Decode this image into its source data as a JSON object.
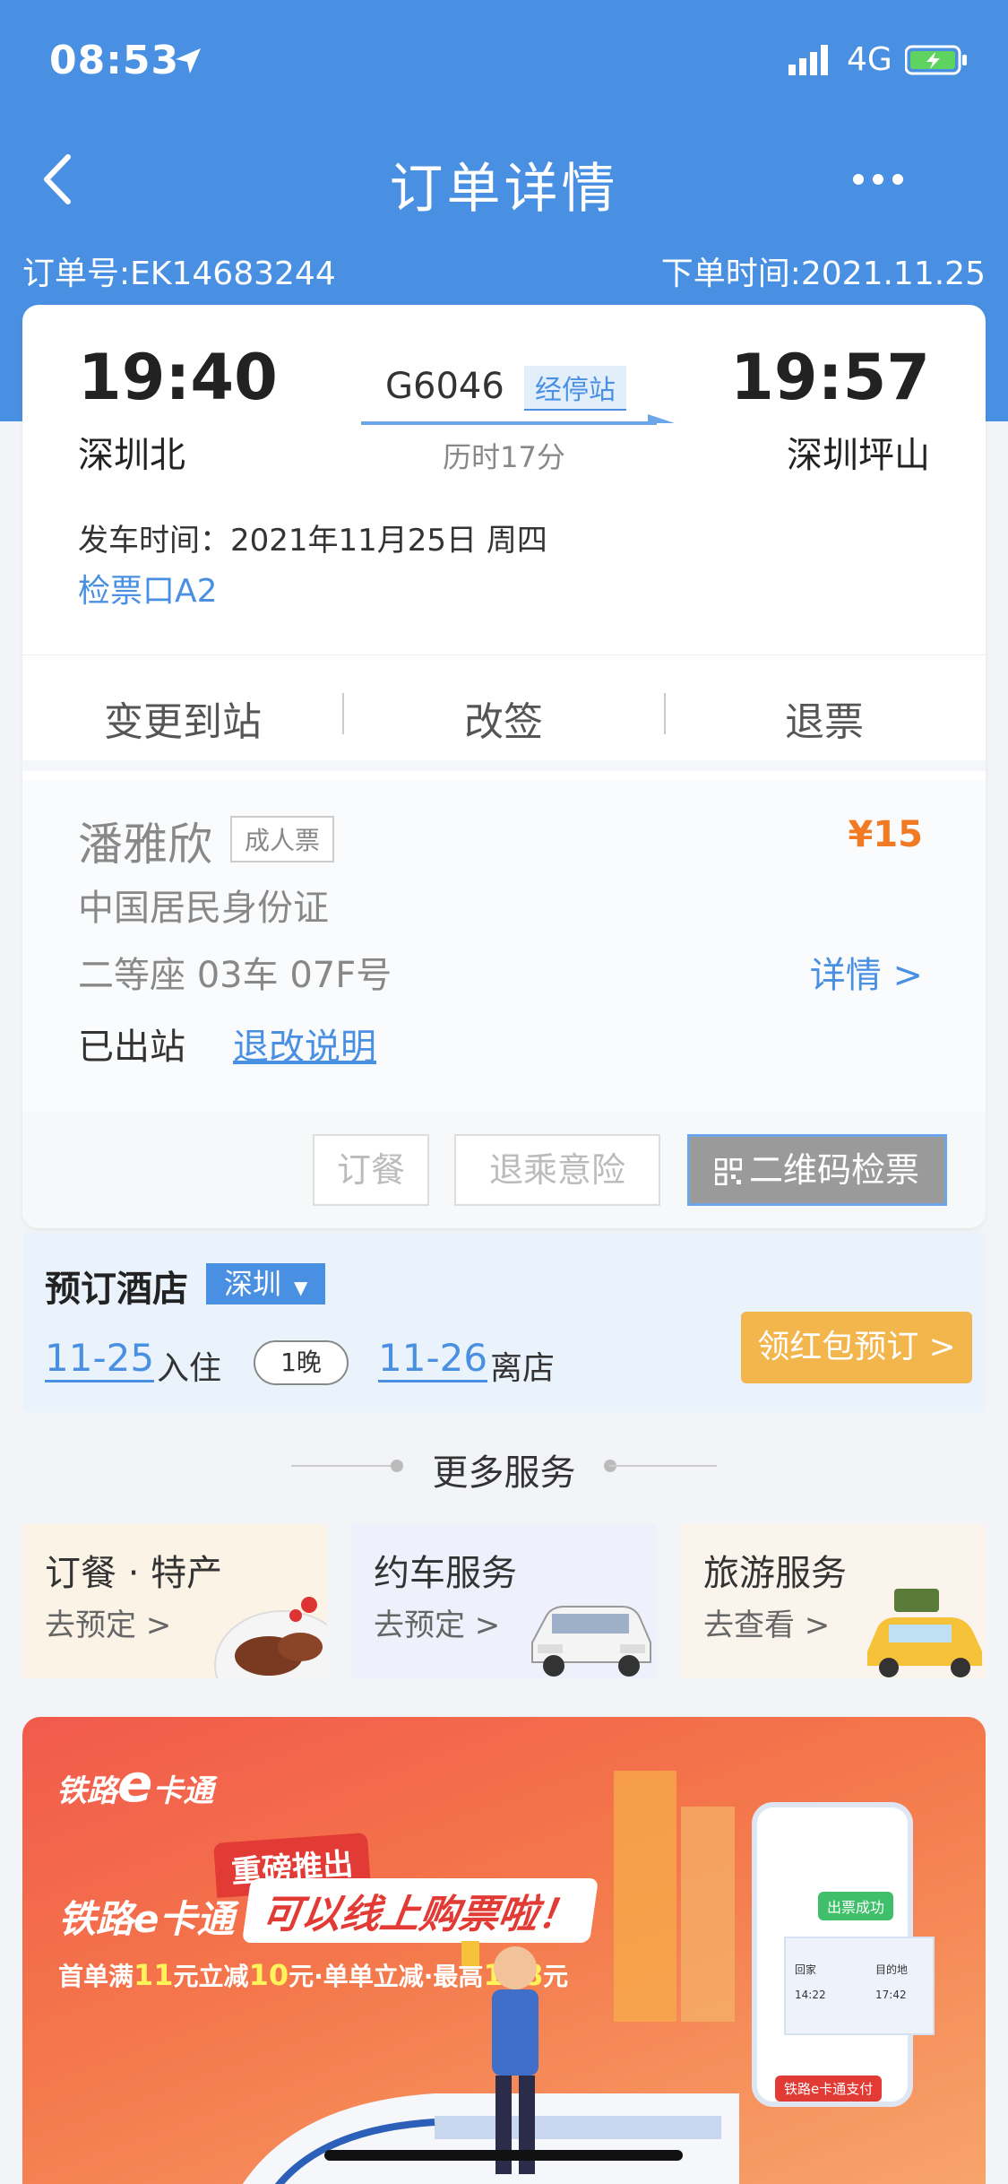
{
  "status_bar": {
    "time": "08:53",
    "network": "4G"
  },
  "nav": {
    "title": "订单详情"
  },
  "order": {
    "number": "订单号:EK14683244",
    "order_time": "下单时间:2021.11.25"
  },
  "trip": {
    "depart_time": "19:40",
    "depart_station": "深圳北",
    "arrive_time": "19:57",
    "arrive_station": "深圳坪山",
    "train_no": "G6046",
    "stops_label": "经停站",
    "duration": "历时17分",
    "depart_date": "发车时间：2021年11月25日 周四",
    "gate": "检票口A2"
  },
  "actions": {
    "change_station": "变更到站",
    "reschedule": "改签",
    "refund": "退票"
  },
  "passenger": {
    "name": "潘雅欣",
    "ticket_type": "成人票",
    "price": "¥15",
    "id_type": "中国居民身份证",
    "seat": "二等座 03车 07F号",
    "detail": "详情 >",
    "status": "已出站",
    "rules": "退改说明"
  },
  "ticket_buttons": {
    "meal": "订餐",
    "insurance": "退乘意险",
    "qr": "二维码检票"
  },
  "hotel": {
    "title": "预订酒店",
    "city": "深圳",
    "checkin_date": "11-25",
    "checkin_label": "入住",
    "nights": "1晚",
    "checkout_date": "11-26",
    "checkout_label": "离店",
    "book": "领红包预订 >"
  },
  "more_services": {
    "title": "更多服务",
    "items": [
      {
        "title": "订餐 · 特产",
        "sub": "去预定 >"
      },
      {
        "title": "约车服务",
        "sub": "去预定 >"
      },
      {
        "title": "旅游服务",
        "sub": "去查看 >"
      }
    ]
  },
  "banner": {
    "logo_prefix": "铁路",
    "logo_e": "e",
    "logo_suffix": "卡通",
    "tag": "重磅推出",
    "headline": "铁路e卡通",
    "headline_highlight": "可以线上购票啦！",
    "sub_1": "首单满",
    "sub_2": "11",
    "sub_3": "元立减",
    "sub_4": "10",
    "sub_5": "元·单单立减·最高",
    "sub_6": "198",
    "sub_7": "元",
    "phone_status": "出票成功",
    "ticket_from": "回家",
    "ticket_to": "目的地",
    "ticket_dep": "14:22",
    "ticket_arr": "17:42",
    "pay_label": "铁路e卡通支付"
  },
  "colors": {
    "primary": "#4a90e2",
    "price": "#f07b24",
    "book": "#f2b64d",
    "banner": "#f25a4c"
  }
}
